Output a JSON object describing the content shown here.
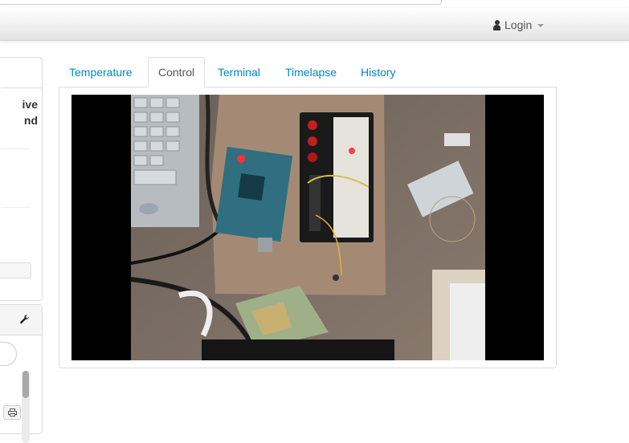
{
  "navbar": {
    "login_label": "Login",
    "user_icon": "user-icon",
    "caret_icon": "caret-down-icon"
  },
  "sidebar": {
    "panel_title": "ive\nnd",
    "settings_icon": "wrench-icon",
    "print_icon": "print-icon"
  },
  "tabs": [
    {
      "label": "Temperature",
      "active": false
    },
    {
      "label": "Control",
      "active": true
    },
    {
      "label": "Terminal",
      "active": false
    },
    {
      "label": "Timelapse",
      "active": false
    },
    {
      "label": "History",
      "active": false
    }
  ],
  "colors": {
    "link": "#0088cc",
    "active_tab_text": "#555555",
    "border": "#dddddd",
    "webcam_letterbox": "#000000"
  }
}
